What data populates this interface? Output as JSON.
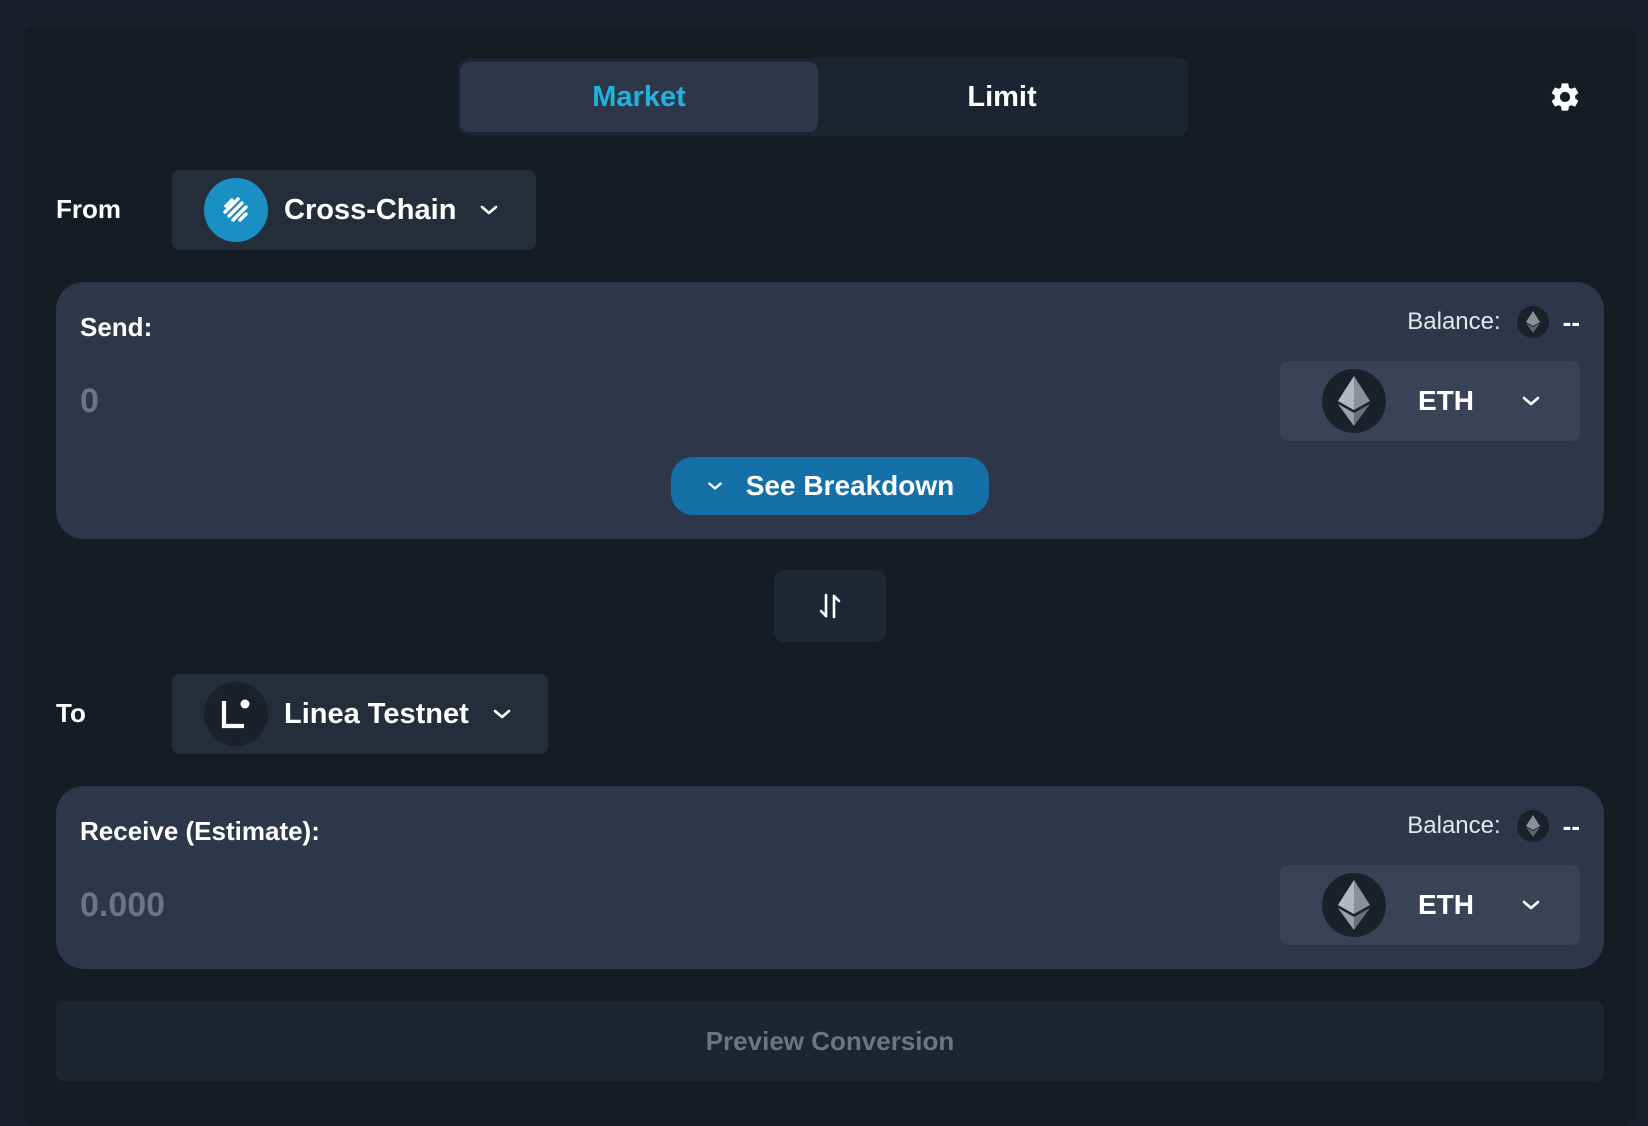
{
  "tabs": {
    "market": "Market",
    "limit": "Limit",
    "active": "market"
  },
  "icons": {
    "settings": "gear-icon",
    "swap": "swap-arrows-icon",
    "chevron": "chevron-down-icon",
    "eth": "ethereum-icon"
  },
  "colors": {
    "accent": "#1cb5e0",
    "button_primary": "#1670a8",
    "panel": "#2e3749",
    "background": "#171b24"
  },
  "from": {
    "label": "From",
    "chain": "Cross-Chain",
    "send": {
      "title": "Send:",
      "balance_label": "Balance:",
      "balance_value": "--",
      "amount": "0",
      "token": "ETH",
      "breakdown_label": "See Breakdown"
    }
  },
  "to": {
    "label": "To",
    "chain": "Linea Testnet",
    "receive": {
      "title": "Receive (Estimate):",
      "balance_label": "Balance:",
      "balance_value": "--",
      "amount": "0.000",
      "token": "ETH"
    }
  },
  "preview": {
    "label": "Preview Conversion"
  }
}
